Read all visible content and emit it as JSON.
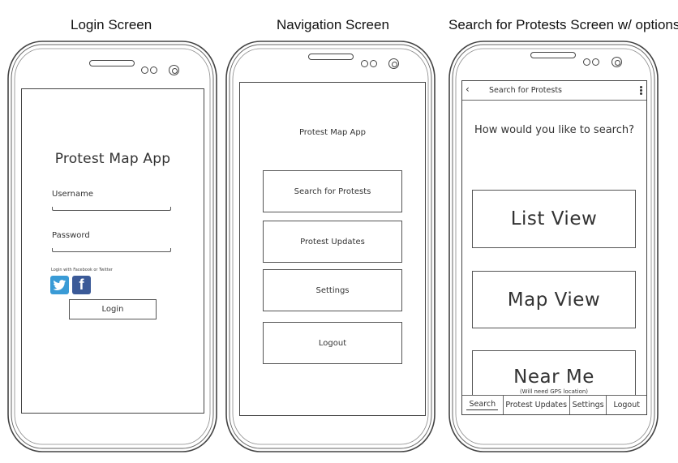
{
  "captions": {
    "login": "Login Screen",
    "navigation": "Navigation Screen",
    "search": "Search for Protests Screen w/ options"
  },
  "login_screen": {
    "app_title": "Protest Map App",
    "username_label": "Username",
    "password_label": "Password",
    "social_hint": "Login with Facebook or Twitter",
    "twitter_icon": "twitter-icon",
    "facebook_icon": "facebook-icon",
    "facebook_glyph": "f",
    "login_button": "Login"
  },
  "navigation_screen": {
    "app_title": "Protest Map App",
    "buttons": [
      "Search for Protests",
      "Protest Updates",
      "Settings",
      "Logout"
    ]
  },
  "search_screen": {
    "back_glyph": "‹",
    "header_title": "Search for Protests",
    "question": "How would you like to search?",
    "options": [
      {
        "label": "List View",
        "sub": ""
      },
      {
        "label": "Map View",
        "sub": ""
      },
      {
        "label": "Near Me",
        "sub": "(Will need GPS location)"
      }
    ],
    "tabs": [
      "Search",
      "Protest Updates",
      "Settings",
      "Logout"
    ],
    "active_tab": "Search"
  },
  "colors": {
    "twitter": "#3a9bd6",
    "facebook": "#3b5a98",
    "outline": "#444444"
  }
}
